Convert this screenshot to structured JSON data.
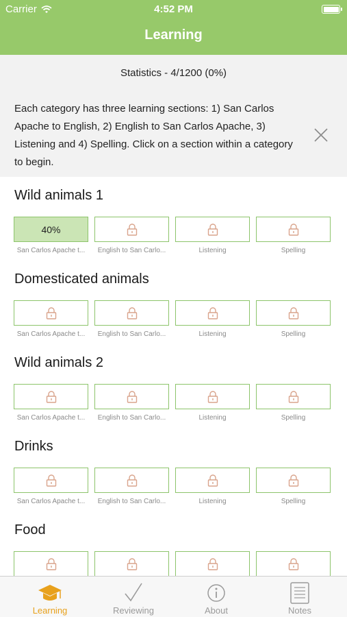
{
  "status_bar": {
    "carrier": "Carrier",
    "time": "4:52 PM"
  },
  "nav": {
    "title": "Learning"
  },
  "info": {
    "stats": "Statistics - 4/1200 (0%)",
    "text": "Each category has three learning sections: 1) San Carlos Apache to English, 2) English to San Carlos Apache, 3) Listening and 4) Spelling. Click on a section within a category to begin."
  },
  "section_labels": [
    "San Carlos Apache t...",
    "English to San Carlo...",
    "Listening",
    "Spelling"
  ],
  "categories": [
    {
      "title": "Wild animals 1",
      "progress": "40%"
    },
    {
      "title": "Domesticated animals"
    },
    {
      "title": "Wild animals 2"
    },
    {
      "title": "Drinks"
    },
    {
      "title": "Food"
    }
  ],
  "tabs": [
    {
      "label": "Learning",
      "icon": "graduation-cap-icon",
      "active": true
    },
    {
      "label": "Reviewing",
      "icon": "checkmark-icon"
    },
    {
      "label": "About",
      "icon": "info-icon"
    },
    {
      "label": "Notes",
      "icon": "notes-icon"
    }
  ],
  "colors": {
    "header": "#97c96a",
    "tile_border": "#8cc46a",
    "progress_fill": "#cbe5b5",
    "lock": "#d9a48c",
    "tab_active": "#e8a11c"
  }
}
